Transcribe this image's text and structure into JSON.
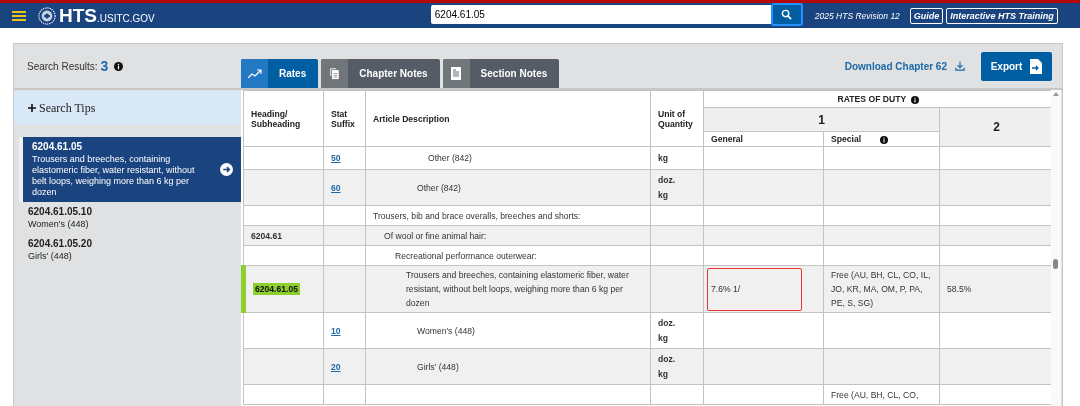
{
  "header": {
    "logo_main": "HTS",
    "logo_domain": ".USITC.GOV",
    "search": {
      "value": "6204.61.05"
    },
    "revision": "2025 HTS Revision 12",
    "buttons": [
      "Guide",
      "Interactive HTS Training"
    ]
  },
  "toolbar": {
    "results_label": "Search Results:",
    "results_count": "3",
    "tabs": [
      {
        "label": "Rates",
        "selected": true,
        "kind": "chart"
      },
      {
        "label": "Chapter Notes",
        "selected": false,
        "kind": "pages"
      },
      {
        "label": "Section Notes",
        "selected": false,
        "kind": "page"
      }
    ],
    "download_link": "Download Chapter 62",
    "export_button": "Export"
  },
  "sidebar": {
    "search_tips": "Search Tips",
    "results": [
      {
        "code": "6204.61.05",
        "description": "Trousers and breeches, containing elastomeric fiber, water resistant, without belt loops, weighing more than 6 kg per dozen",
        "selected": true
      },
      {
        "code": "6204.61.05.10",
        "description": "Women's (448)",
        "selected": false
      },
      {
        "code": "6204.61.05.20",
        "description": "Girls' (448)",
        "selected": false
      }
    ]
  },
  "table": {
    "columns": {
      "heading": "Heading/ Subheading",
      "stat": "Stat Suffix",
      "description": "Article Description",
      "unit": "Unit of Quantity",
      "rates": "RATES OF DUTY",
      "column_1": "1",
      "general": "General",
      "special": "Special",
      "column_2": "2"
    },
    "rows": [
      {
        "children": [
          {
            "children": [
              {
                "children": [
                  {
                    "children": [
                      {
                        "children": [
                          {
                            "stat": "50",
                            "description": "Other (842)",
                            "unit": [
                              "kg"
                            ],
                            "selected": false,
                            "outlined": false
                          }
                        ]
                      },
                      {
                        "stat": "60",
                        "description": "Other (842)",
                        "unit": [
                          "doz.",
                          "kg"
                        ],
                        "selected": false,
                        "outlined": false
                      }
                    ]
                  }
                ]
              }
            ]
          }
        ]
      },
      {
        "description": "Trousers, bib and brace overalls, breeches and shorts:",
        "selected": false,
        "outlined": false,
        "children": [
          {
            "heading": "6204.61",
            "description": "Of wool or fine animal hair:",
            "selected": false,
            "outlined": false,
            "children": [
              {
                "description": "Recreational performance outerwear:",
                "selected": false,
                "outlined": false,
                "children": [
                  {
                    "heading": "6204.61.05",
                    "description": "Trousers and breeches, containing elastomeric fiber, water resistant, without belt loops, weighing more than 6 kg per dozen",
                    "general": "7.6% 1/",
                    "special": "Free (AU, BH, CL, CO, IL, JO, KR, MA, OM, P, PA, PE, S, SG)",
                    "column_2": "58.5%",
                    "selected": true,
                    "outlined": true,
                    "children": [
                      {
                        "stat": "10",
                        "description": "Women's (448)",
                        "unit": [
                          "doz.",
                          "kg"
                        ],
                        "selected": false,
                        "outlined": false
                      },
                      {
                        "stat": "20",
                        "description": "Girls' (448)",
                        "unit": [
                          "doz.",
                          "kg"
                        ],
                        "selected": false,
                        "outlined": false
                      }
                    ]
                  }
                ]
              }
            ]
          }
        ]
      },
      {
        "special": "Free (AU, BH, CL, CO,",
        "selected": false,
        "outlined": false
      }
    ]
  }
}
